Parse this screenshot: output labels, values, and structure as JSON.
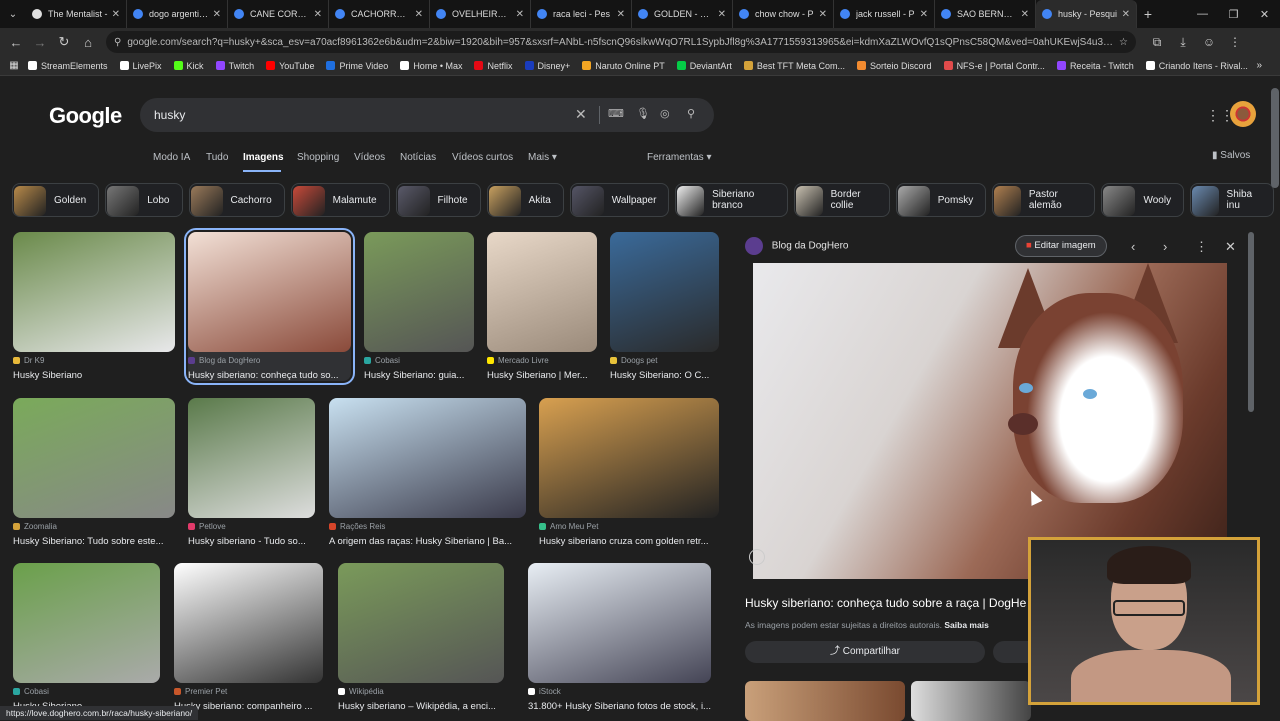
{
  "browser": {
    "tabs": [
      {
        "title": "The Mentalist -",
        "color": "#e0e0e0"
      },
      {
        "title": "dogo argentino",
        "color": "#4285f4"
      },
      {
        "title": "CANE CORSO",
        "color": "#4285f4"
      },
      {
        "title": "CACHORRO Q",
        "color": "#4285f4"
      },
      {
        "title": "OVELHEIRO G",
        "color": "#4285f4"
      },
      {
        "title": "raca leci - Pes",
        "color": "#4285f4"
      },
      {
        "title": "GOLDEN - Pes",
        "color": "#4285f4"
      },
      {
        "title": "chow chow - P",
        "color": "#4285f4"
      },
      {
        "title": "jack russell - P",
        "color": "#4285f4"
      },
      {
        "title": "SAO BERNARD",
        "color": "#4285f4"
      },
      {
        "title": "husky - Pesqui",
        "color": "#4285f4"
      }
    ],
    "url": "google.com/search?q=husky+&sca_esv=a70acf8961362e6b&udm=2&biw=1920&bih=957&sxsrf=ANbL-n5fscnQ96slkwWqO7RL1SypbJfl8g%3A1771559313965&ei=kdmXaZLWOvfQ1sQPnsC58QM&ved=0ahUKEwjS4u3clOeSAxV3qIUCHR5gJ...",
    "bookmarks": [
      {
        "label": "StreamElements",
        "color": "#ffffff"
      },
      {
        "label": "LivePix",
        "color": "#ffffff"
      },
      {
        "label": "Kick",
        "color": "#53fc18"
      },
      {
        "label": "Twitch",
        "color": "#9146ff"
      },
      {
        "label": "YouTube",
        "color": "#ff0000"
      },
      {
        "label": "Prime Video",
        "color": "#1f6fe0"
      },
      {
        "label": "Home • Max",
        "color": "#ffffff"
      },
      {
        "label": "Netflix",
        "color": "#e50914"
      },
      {
        "label": "Disney+",
        "color": "#1a3cbd"
      },
      {
        "label": "Naruto Online PT",
        "color": "#f5a623"
      },
      {
        "label": "DeviantArt",
        "color": "#05cc47"
      },
      {
        "label": "Best TFT Meta Com...",
        "color": "#d4a23a"
      },
      {
        "label": "Sorteio Discord",
        "color": "#f28b30"
      },
      {
        "label": "NFS-e | Portal Contr...",
        "color": "#e14b4b"
      },
      {
        "label": "Receita - Twitch",
        "color": "#9146ff"
      },
      {
        "label": "Criando Itens - Rival...",
        "color": "#ffffff"
      }
    ]
  },
  "google": {
    "logo": "Google",
    "query": "husky",
    "filters": [
      "Modo IA",
      "Tudo",
      "Imagens",
      "Shopping",
      "Vídeos",
      "Notícias",
      "Vídeos curtos",
      "Mais ▾"
    ],
    "tools": "Ferramentas ▾",
    "saved": "Salvos",
    "chips": [
      "Golden",
      "Lobo",
      "Cachorro",
      "Malamute",
      "Filhote",
      "Akita",
      "Wallpaper",
      "Siberiano branco",
      "Border collie",
      "Pomsky",
      "Pastor alemão",
      "Wooly",
      "Shiba inu"
    ],
    "results": [
      {
        "source": "Dr K9",
        "caption": "Husky Siberiano",
        "color": "#e8b93a"
      },
      {
        "source": "Blog da DogHero",
        "caption": "Husky siberiano: conheça tudo so...",
        "color": "#5b3d8f"
      },
      {
        "source": "Cobasi",
        "caption": "Husky Siberiano: guia...",
        "color": "#2aa6a0"
      },
      {
        "source": "Mercado Livre",
        "caption": "Husky Siberiano | Mer...",
        "color": "#ffe600"
      },
      {
        "source": "Doogs pet",
        "caption": "Husky Siberiano: O C...",
        "color": "#e8c23a"
      },
      {
        "source": "Zoomalia",
        "caption": "Husky Siberiano: Tudo sobre este...",
        "color": "#d4a23a"
      },
      {
        "source": "Petlove",
        "caption": "Husky siberiano - Tudo so...",
        "color": "#e23a6a"
      },
      {
        "source": "Rações Reis",
        "caption": "A origem das raças: Husky Siberiano | Ba...",
        "color": "#d6452a"
      },
      {
        "source": "Amo Meu Pet",
        "caption": "Husky siberiano cruza com golden retr...",
        "color": "#36c08a"
      },
      {
        "source": "Cobasi",
        "caption": "Husky Siberiano...",
        "color": "#2aa6a0"
      },
      {
        "source": "Premier Pet",
        "caption": "Husky siberiano: companheiro ...",
        "color": "#c8572a"
      },
      {
        "source": "Wikipédia",
        "caption": "Husky siberiano – Wikipédia, a enci...",
        "color": "#ffffff"
      },
      {
        "source": "iStock",
        "caption": "31.800+ Husky Siberiano fotos de stock, i...",
        "color": "#ffffff"
      }
    ],
    "panel": {
      "source": "Blog da DogHero",
      "edit_label": "Editar imagem",
      "title": "Husky siberiano: conheça tudo sobre a raça | DogHe",
      "note": "As imagens podem estar sujeitas a direitos autorais.",
      "note_link": "Saiba mais",
      "share_label": "Compartilhar"
    },
    "status_url": "https://love.doghero.com.br/raca/husky-siberiano/"
  }
}
